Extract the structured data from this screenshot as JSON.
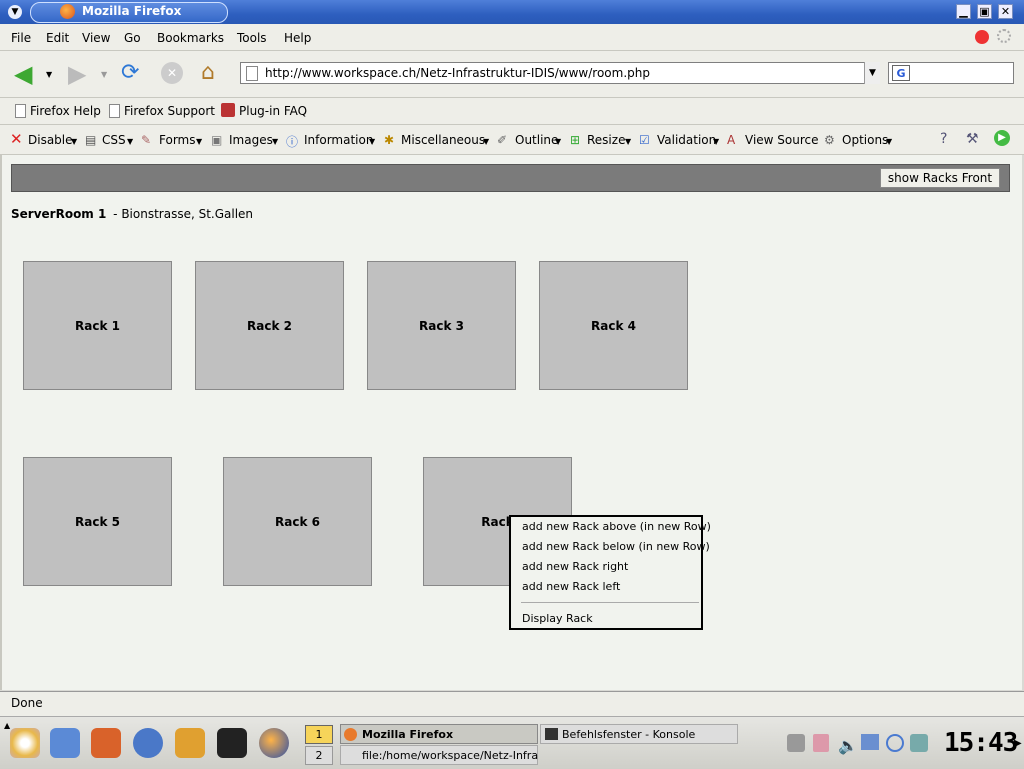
{
  "window": {
    "title": "Mozilla Firefox"
  },
  "menus": [
    "File",
    "Edit",
    "View",
    "Go",
    "Bookmarks",
    "Tools",
    "Help"
  ],
  "nav": {
    "url": "http://www.workspace.ch/Netz-Infrastruktur-IDIS/www/room.php",
    "search_engine_icon": "google-icon"
  },
  "bookmarks": [
    "Firefox Help",
    "Firefox Support",
    "Plug-in FAQ"
  ],
  "devtools": [
    "Disable",
    "CSS",
    "Forms",
    "Images",
    "Information",
    "Miscellaneous",
    "Outline",
    "Resize",
    "Validation",
    "View Source",
    "Options"
  ],
  "page": {
    "show_button": "show Racks Front",
    "room_name": "ServerRoom 1",
    "room_location": "- Bionstrasse, St.Gallen",
    "racks": [
      "Rack 1",
      "Rack 2",
      "Rack 3",
      "Rack 4",
      "Rack 5",
      "Rack 6",
      "Rack"
    ]
  },
  "context_menu": {
    "items": [
      "add new Rack above (in new Row)",
      "add new Rack below (in new Row)",
      "add new Rack right",
      "add new Rack left"
    ],
    "display": "Display Rack"
  },
  "status": "Done",
  "taskbar": {
    "desktops": [
      "1",
      "2"
    ],
    "tasks": [
      "Mozilla Firefox",
      "file:/home/workspace/Netz-Infrastrukt",
      "Befehlsfenster - Konsole"
    ],
    "clock": "15:43"
  }
}
